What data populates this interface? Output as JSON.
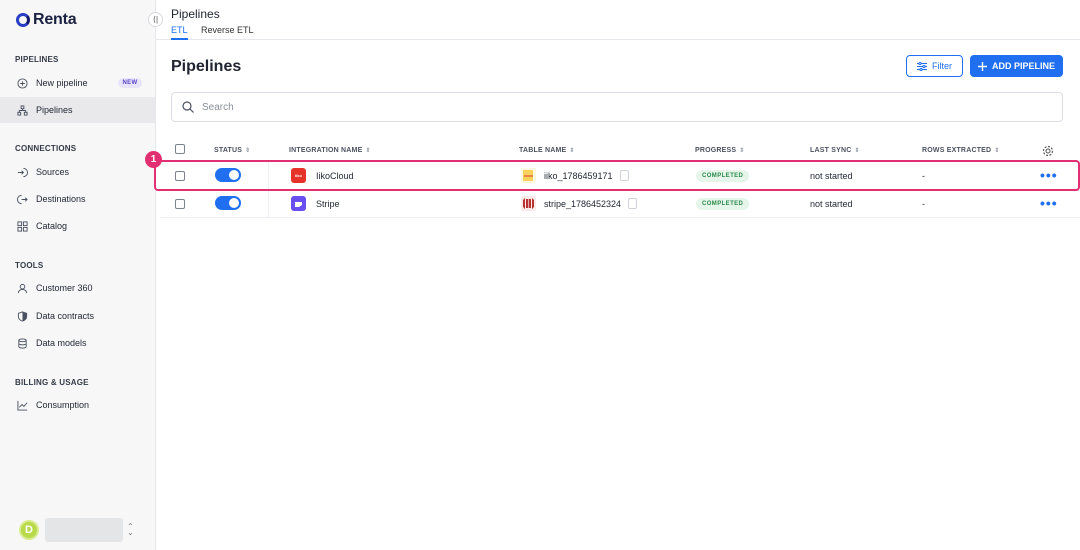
{
  "app": {
    "name": "Renta"
  },
  "sidebar": {
    "sections": [
      {
        "title": "PIPELINES"
      },
      {
        "title": "CONNECTIONS"
      },
      {
        "title": "TOOLS"
      },
      {
        "title": "BILLING & USAGE"
      }
    ],
    "items": [
      {
        "label": "New pipeline",
        "icon": "plus-circle-icon",
        "badge": "NEW"
      },
      {
        "label": "Pipelines",
        "icon": "hierarchy-icon",
        "active": true
      },
      {
        "label": "Sources",
        "icon": "sign-in-icon"
      },
      {
        "label": "Destinations",
        "icon": "sign-out-icon"
      },
      {
        "label": "Catalog",
        "icon": "grid-icon"
      },
      {
        "label": "Customer 360",
        "icon": "user-icon"
      },
      {
        "label": "Data contracts",
        "icon": "shield-icon"
      },
      {
        "label": "Data models",
        "icon": "database-icon"
      },
      {
        "label": "Consumption",
        "icon": "chart-line-icon"
      }
    ],
    "user": {
      "initial": "D"
    },
    "collapse_glyph": "⟨|"
  },
  "header": {
    "title": "Pipelines",
    "tabs": [
      {
        "label": "ETL",
        "active": true
      },
      {
        "label": "Reverse ETL"
      }
    ]
  },
  "main": {
    "title": "Pipelines",
    "filter_label": "Filter",
    "add_label": "ADD PIPELINE",
    "search_placeholder": "Search"
  },
  "table": {
    "columns": [
      "STATUS",
      "INTEGRATION NAME",
      "TABLE NAME",
      "PROGRESS",
      "LAST SYNC",
      "ROWS EXTRACTED"
    ],
    "rows": [
      {
        "enabled": true,
        "integration": "IikoCloud",
        "integration_logo_text": "iiko",
        "table": "iiko_1786459171",
        "progress": "COMPLETED",
        "last_sync": "not started",
        "rows": "-"
      },
      {
        "enabled": true,
        "integration": "Stripe",
        "table": "stripe_1786452324",
        "progress": "COMPLETED",
        "last_sync": "not started",
        "rows": "-"
      }
    ]
  },
  "annotation": {
    "marker": "1"
  },
  "colors": {
    "accent": "#1f6ff0",
    "highlight": "#e22f71",
    "success_bg": "#e6f5ea",
    "success_text": "#2a8a4a"
  }
}
